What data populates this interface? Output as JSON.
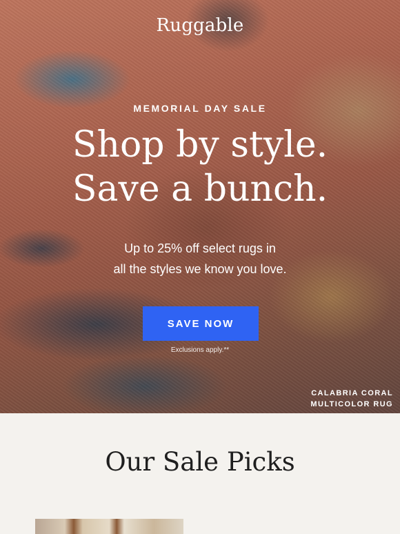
{
  "brand": {
    "logo": "Ruggable"
  },
  "hero": {
    "eyebrow": "MEMORIAL DAY SALE",
    "headline_line1": "Shop by style.",
    "headline_line2": "Save a bunch.",
    "sub_line1": "Up to 25% off select rugs in",
    "sub_line2": "all the styles we know you love.",
    "cta_label": "SAVE NOW",
    "cta_color": "#2f63f3",
    "exclusions": "Exclusions apply.**",
    "caption_line1": "CALABRIA CORAL",
    "caption_line2": "MULTICOLOR RUG"
  },
  "sale_picks": {
    "title": "Our Sale Picks"
  }
}
